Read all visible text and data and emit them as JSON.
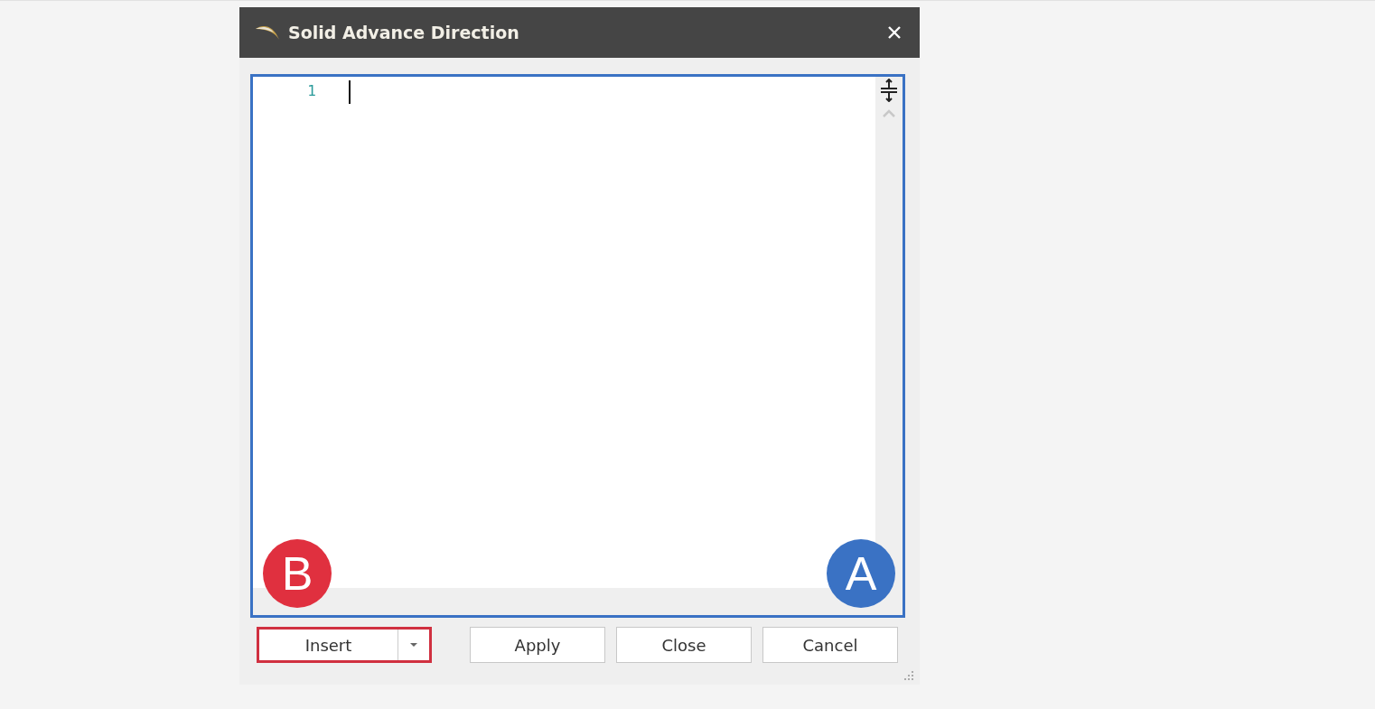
{
  "window": {
    "title": "Solid Advance Direction"
  },
  "editor": {
    "line_numbers": [
      "1"
    ],
    "highlighted": true
  },
  "callouts": [
    {
      "label": "B",
      "color": "#e0303f"
    },
    {
      "label": "A",
      "color": "#3a72c4"
    }
  ],
  "buttons": [
    {
      "label": "Insert",
      "kind": "split",
      "highlighted": true
    },
    {
      "label": "Apply",
      "kind": "plain",
      "highlighted": false
    },
    {
      "label": "Close",
      "kind": "plain",
      "highlighted": false
    },
    {
      "label": "Cancel",
      "kind": "plain",
      "highlighted": false
    }
  ]
}
